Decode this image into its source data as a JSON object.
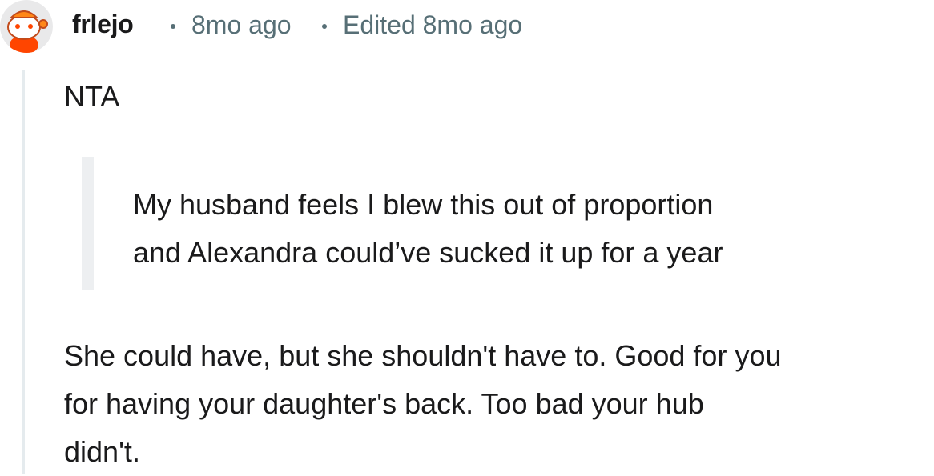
{
  "comment": {
    "username": "frlejo",
    "time": "8mo ago",
    "edited": "Edited 8mo ago",
    "body_first": "NTA",
    "quote_lines": [
      "My husband feels I blew this out of proportion",
      "and Alexandra could’ve sucked it up for a year"
    ],
    "body_lines": [
      "She could have, but she shouldn't have to. Good for you",
      "for having your daughter's back. Too bad your hub",
      "didn't."
    ]
  },
  "colors": {
    "avatar_bg": "#e9e9ea",
    "avatar_character": "#ff4500",
    "meta_text": "#576f76",
    "thread_line": "#e5ebee",
    "quote_bar": "#edeff1"
  },
  "icons": {
    "avatar": "reddit-snoo-avatar"
  }
}
